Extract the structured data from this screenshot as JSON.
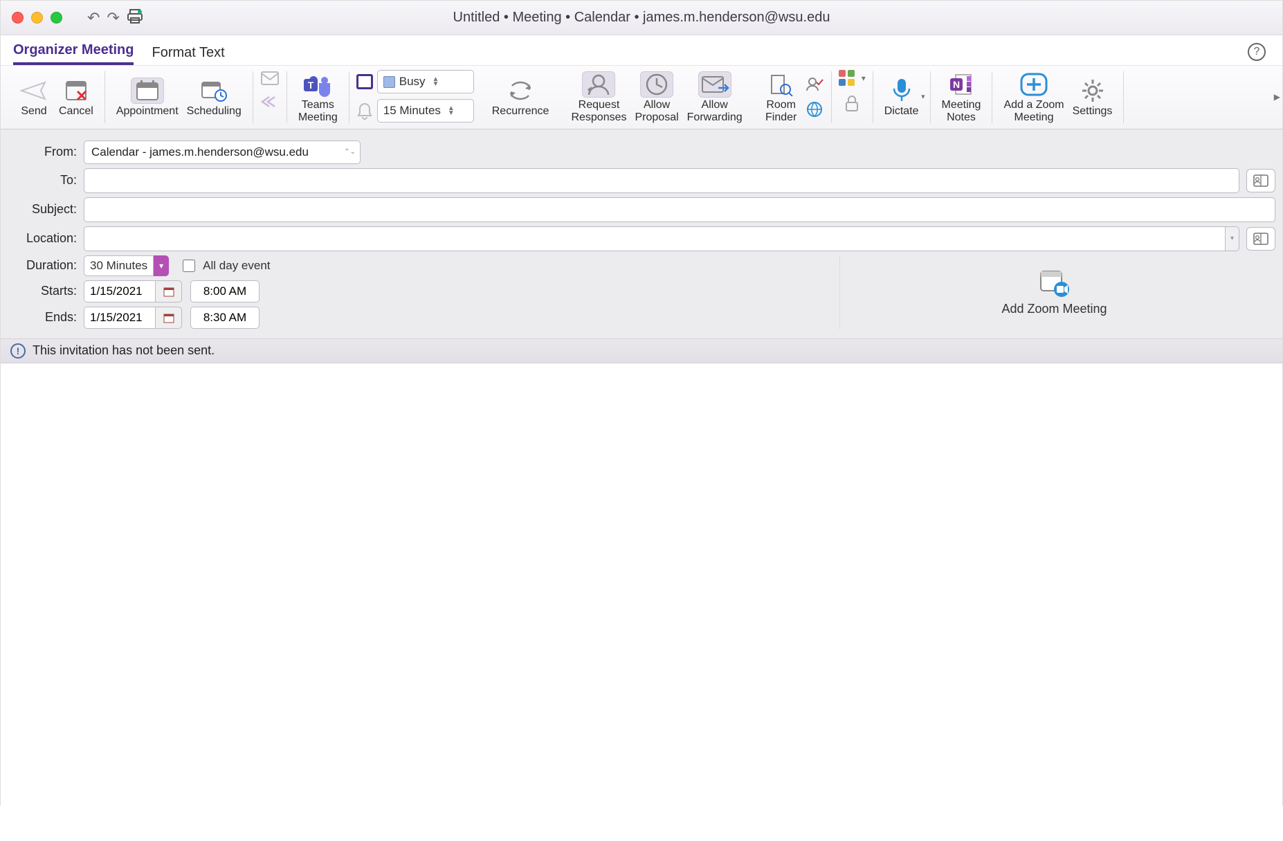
{
  "window": {
    "title": "Untitled • Meeting • Calendar • james.m.henderson@wsu.edu"
  },
  "tabs": {
    "organizer": "Organizer Meeting",
    "formatText": "Format Text"
  },
  "ribbon": {
    "send": "Send",
    "cancel": "Cancel",
    "appointment": "Appointment",
    "scheduling": "Scheduling",
    "teams": "Teams\nMeeting",
    "status": "Busy",
    "reminder": "15 Minutes",
    "recurrence": "Recurrence",
    "requestResponses": "Request\nResponses",
    "allowProposal": "Allow\nProposal",
    "allowForwarding": "Allow\nForwarding",
    "roomFinder": "Room\nFinder",
    "dictate": "Dictate",
    "meetingNotes": "Meeting\nNotes",
    "addZoom": "Add a Zoom\nMeeting",
    "settings": "Settings"
  },
  "form": {
    "labels": {
      "from": "From:",
      "to": "To:",
      "subject": "Subject:",
      "location": "Location:",
      "duration": "Duration:",
      "starts": "Starts:",
      "ends": "Ends:"
    },
    "fromValue": "Calendar - james.m.henderson@wsu.edu",
    "toValue": "",
    "subjectValue": "",
    "locationValue": "",
    "duration": "30 Minutes",
    "allDayLabel": "All day event",
    "allDayChecked": false,
    "startDate": "1/15/2021",
    "startTime": "8:00 AM",
    "endDate": "1/15/2021",
    "endTime": "8:30 AM"
  },
  "rightPane": {
    "addZoomBtn": "Add Zoom Meeting"
  },
  "infoBar": {
    "text": "This invitation has not been sent."
  }
}
